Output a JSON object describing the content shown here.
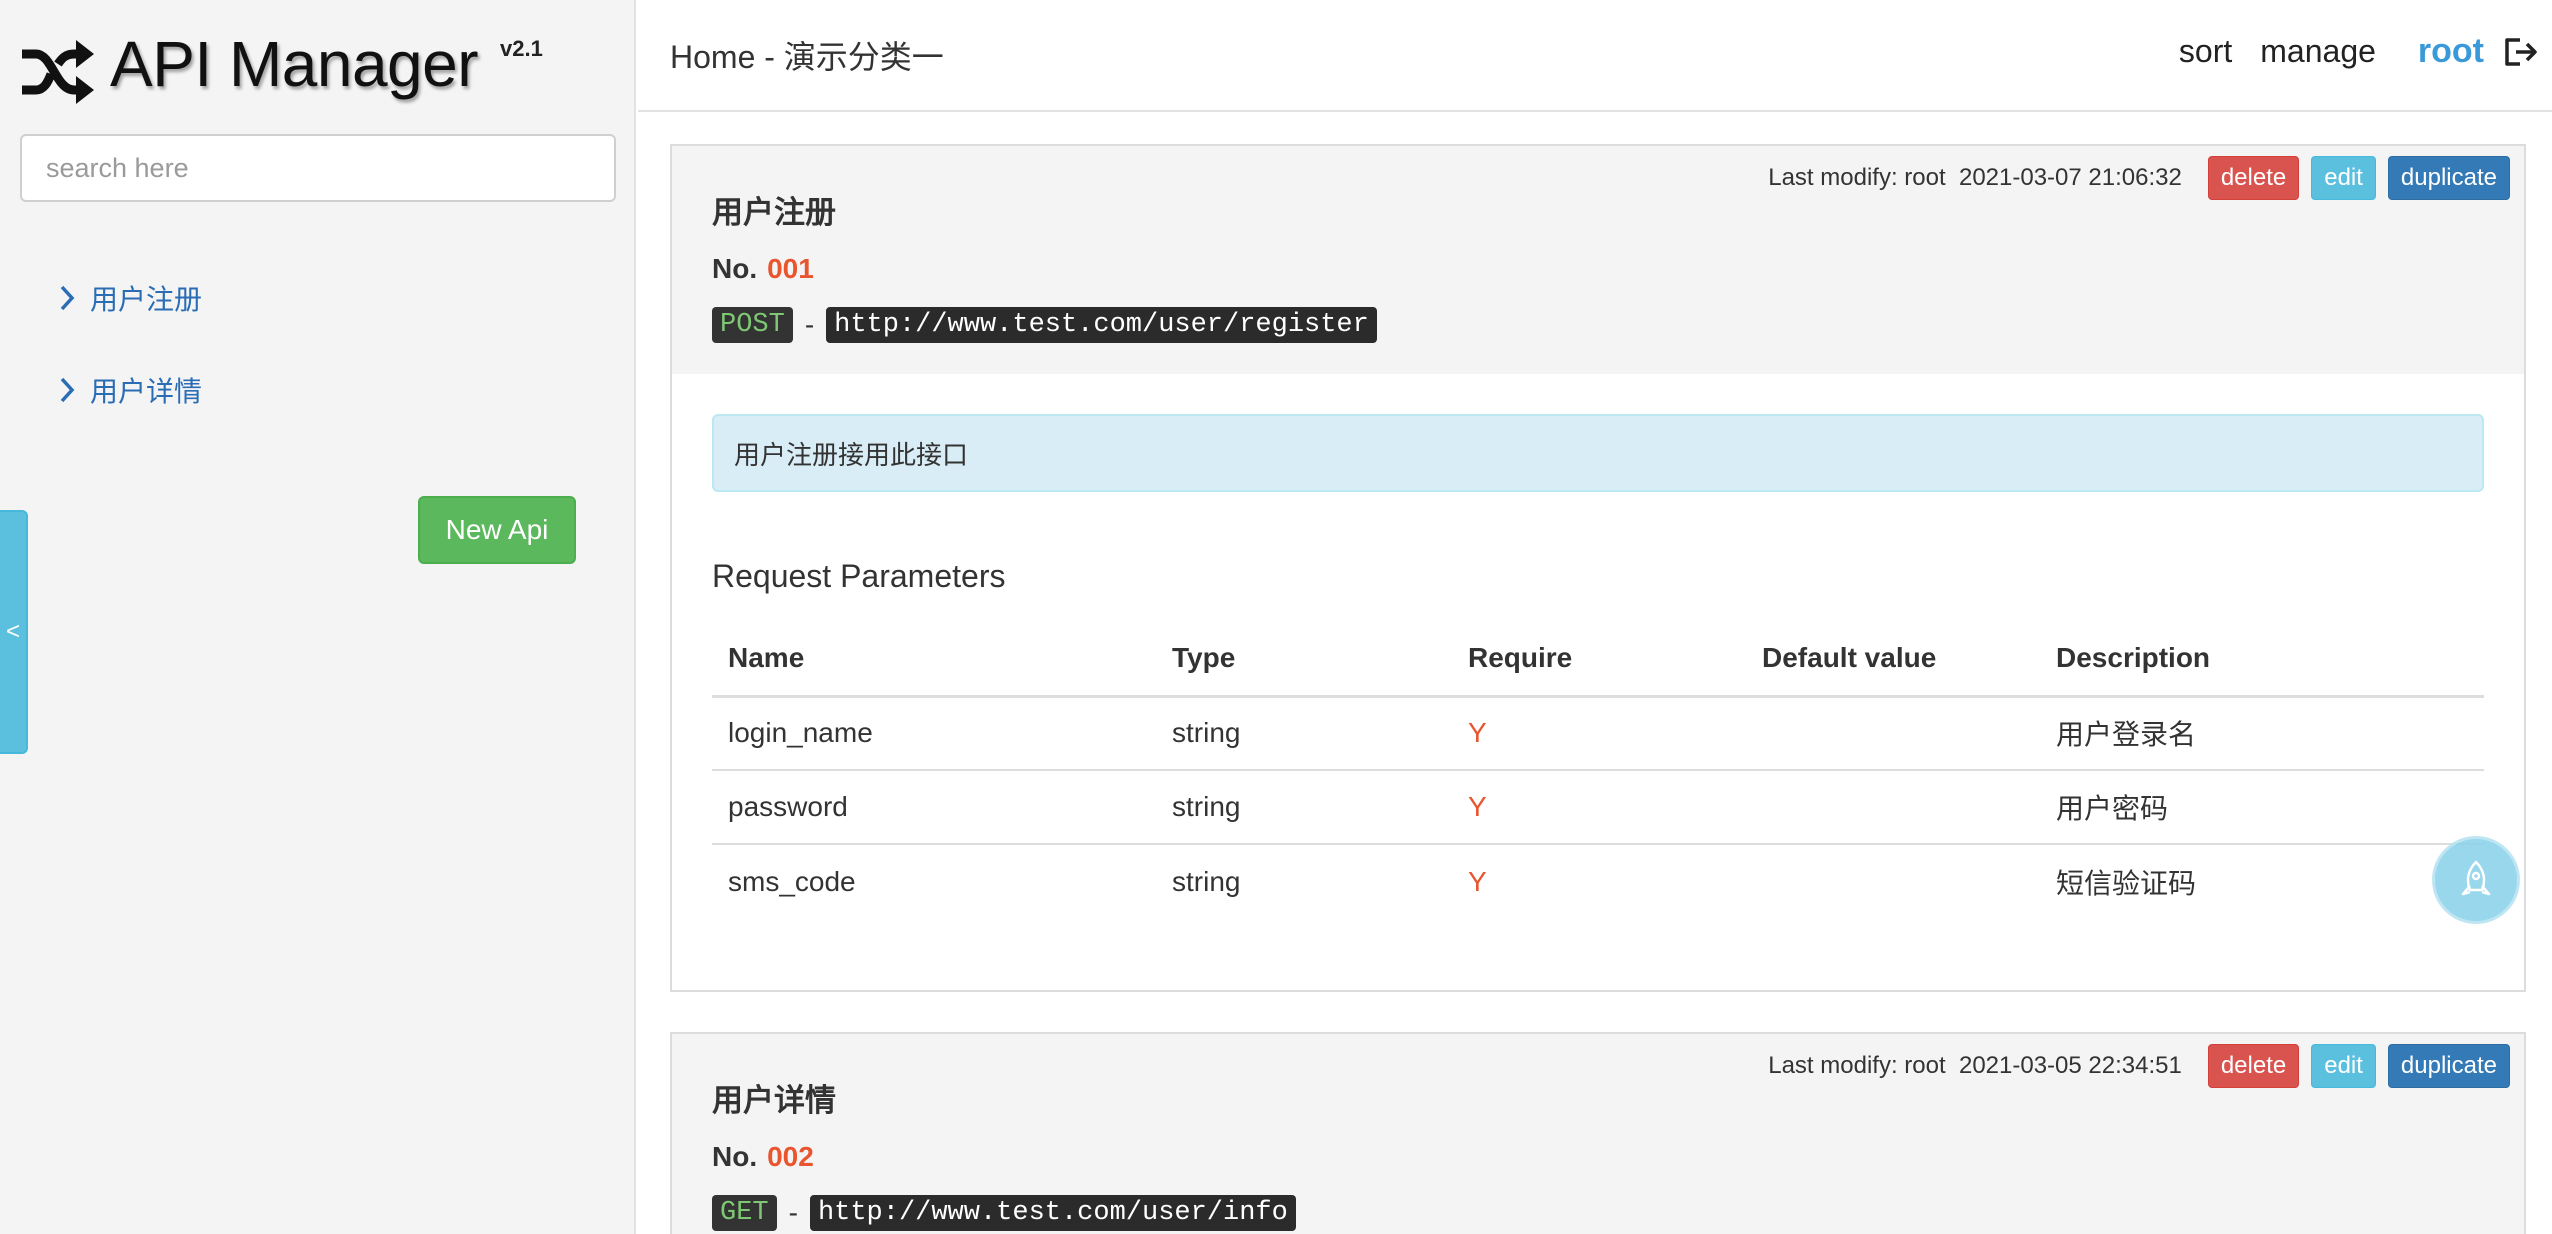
{
  "app": {
    "title": "API Manager",
    "version": "v2.1"
  },
  "search": {
    "placeholder": "search here"
  },
  "sidebar": {
    "items": [
      {
        "label": "用户注册"
      },
      {
        "label": "用户详情"
      }
    ],
    "new_api_label": "New Api",
    "collapse_label": "<"
  },
  "header": {
    "breadcrumb": "Home - 演示分类一",
    "sort_label": "sort",
    "manage_label": "manage",
    "user": "root"
  },
  "apis": [
    {
      "title": "用户注册",
      "no_label": "No.",
      "no": "001",
      "method": "POST",
      "dash": "-",
      "url": "http://www.test.com/user/register",
      "last_modify": "Last modify: root  2021-03-07 21:06:32",
      "delete_label": "delete",
      "edit_label": "edit",
      "duplicate_label": "duplicate",
      "description": "用户注册接用此接口",
      "params_title": "Request Parameters",
      "columns": [
        "Name",
        "Type",
        "Require",
        "Default value",
        "Description"
      ],
      "params": [
        {
          "name": "login_name",
          "type": "string",
          "require": "Y",
          "default": "",
          "description": "用户登录名"
        },
        {
          "name": "password",
          "type": "string",
          "require": "Y",
          "default": "",
          "description": "用户密码"
        },
        {
          "name": "sms_code",
          "type": "string",
          "require": "Y",
          "default": "",
          "description": "短信验证码"
        }
      ]
    },
    {
      "title": "用户详情",
      "no_label": "No.",
      "no": "002",
      "method": "GET",
      "dash": "-",
      "url": "http://www.test.com/user/info",
      "last_modify": "Last modify: root  2021-03-05 22:34:51",
      "delete_label": "delete",
      "edit_label": "edit",
      "duplicate_label": "duplicate"
    }
  ],
  "colors": {
    "accent": "#3a9ad9",
    "link": "#2a6db5",
    "number": "#e8552f",
    "success": "#5cb85c",
    "danger": "#d9534f",
    "info": "#5bc0de",
    "primary": "#337ab7"
  },
  "icons": {
    "logo": "shuffle-icon",
    "nav": "chevron-right-icon",
    "logout": "logout-icon",
    "scroll_top": "rocket-icon"
  }
}
